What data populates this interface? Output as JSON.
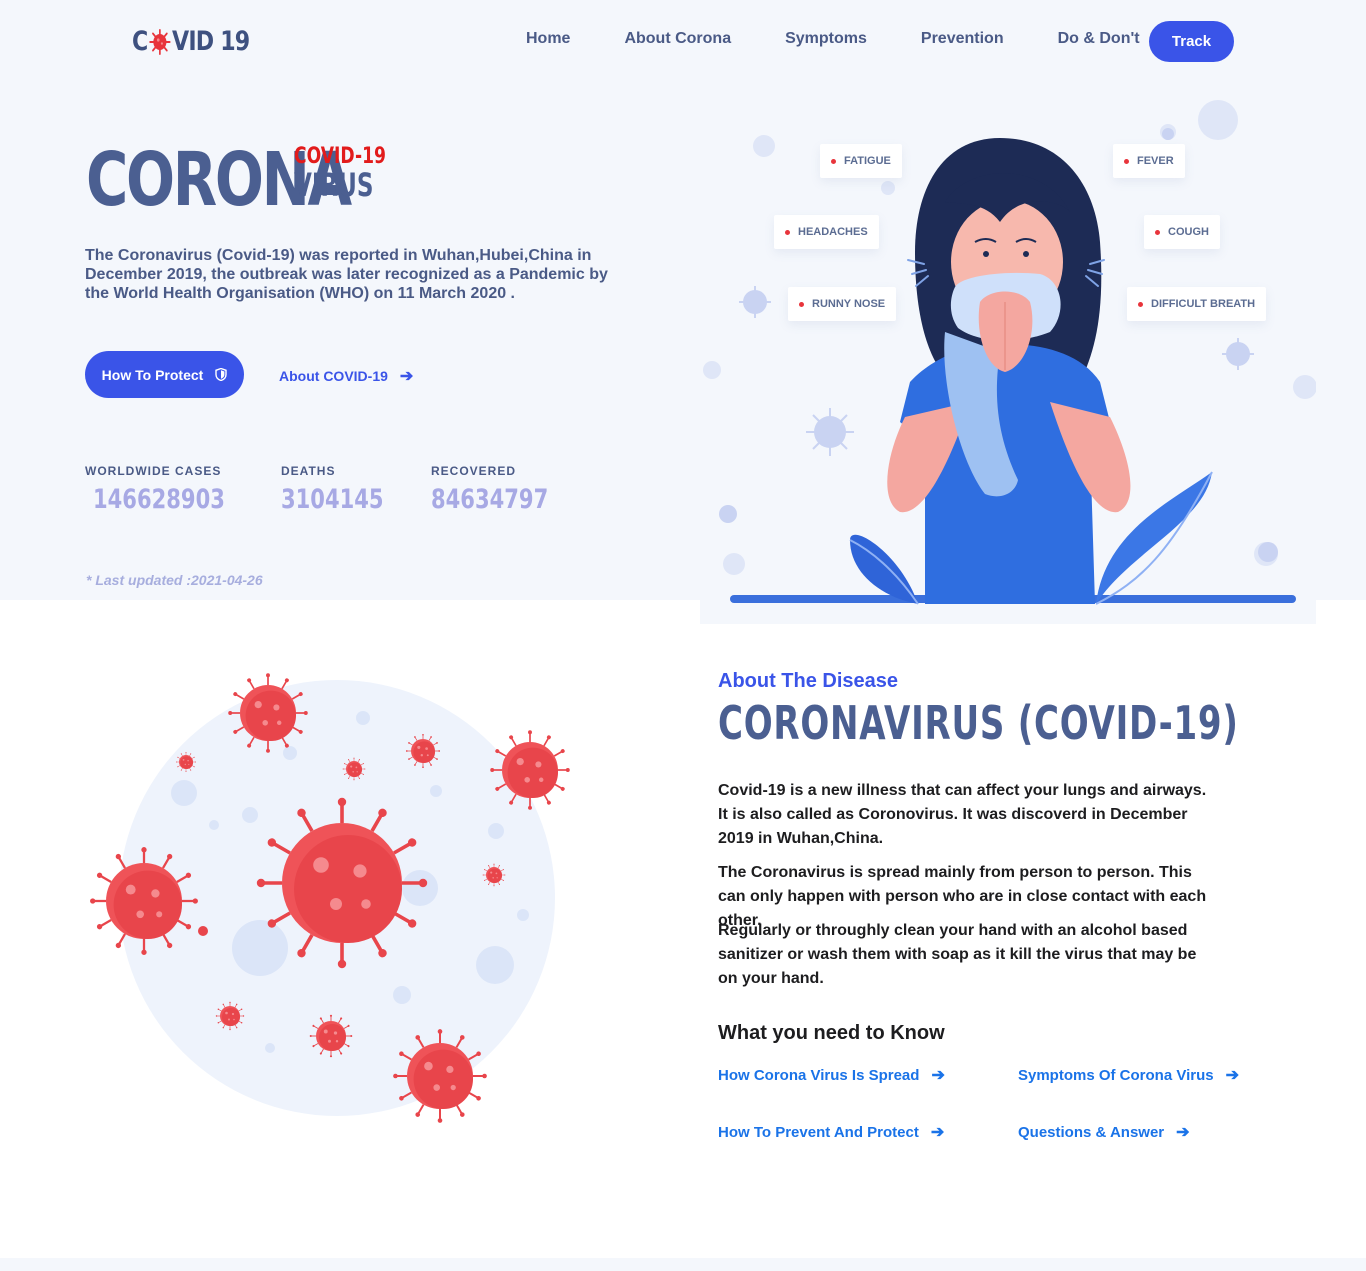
{
  "brand": {
    "logo_left": "C",
    "logo_right": "VID 19",
    "colors": {
      "primary": "#3a54e8",
      "heading": "#4b5f91",
      "red": "#e21b1b",
      "stat": "#a7a9e4",
      "link": "#1a73e8"
    }
  },
  "nav": {
    "items": [
      {
        "label": "Home"
      },
      {
        "label": "About Corona"
      },
      {
        "label": "Symptoms"
      },
      {
        "label": "Prevention"
      },
      {
        "label": "Do & Don't"
      }
    ],
    "track_label": "Track"
  },
  "hero": {
    "title_main": "CORONA",
    "title_tag": "COVID-19",
    "title_sub": "VIRUS",
    "description": "The Coronavirus (Covid-19) was reported in Wuhan,Hubei,China in December 2019, the outbreak was later recognized as a Pandemic by the World Health Organisation (WHO) on 11 March 2020 .",
    "protect_button": "How To Protect",
    "protect_icon": "shield-icon",
    "about_link": "About COVID-19",
    "about_link_icon": "arrow-right-icon",
    "stats": [
      {
        "label": "WORLDWIDE CASES",
        "value": "146628903"
      },
      {
        "label": "DEATHS",
        "value": "3104145"
      },
      {
        "label": "RECOVERED",
        "value": "84634797"
      }
    ],
    "last_updated": "* Last updated :2021-04-26"
  },
  "symptoms": [
    {
      "label": "FATIGUE"
    },
    {
      "label": "FEVER"
    },
    {
      "label": "HEADACHES"
    },
    {
      "label": "COUGH"
    },
    {
      "label": "RUNNY NOSE"
    },
    {
      "label": "DIFFICULT BREATH"
    }
  ],
  "about": {
    "eyebrow": "About The Disease",
    "title": "CORONAVIRUS (COVID-19)",
    "paragraphs": [
      "Covid-19 is a new illness that can affect your lungs and airways. It is also called as Coronovirus. It was discoverd in December 2019 in Wuhan,China.",
      "The Coronavirus is spread mainly from person to person. This can only happen with person who are in close contact with each other.",
      "Regularly or throughly clean your hand with an alcohol based sanitizer or wash them with soap as it kill the virus that may be on your hand."
    ],
    "know_title": "What you need to Know",
    "know_links": [
      {
        "label": "How Corona Virus Is Spread"
      },
      {
        "label": "Symptoms Of Corona Virus"
      },
      {
        "label": "How To Prevent And Protect"
      },
      {
        "label": "Questions & Answer"
      }
    ]
  }
}
